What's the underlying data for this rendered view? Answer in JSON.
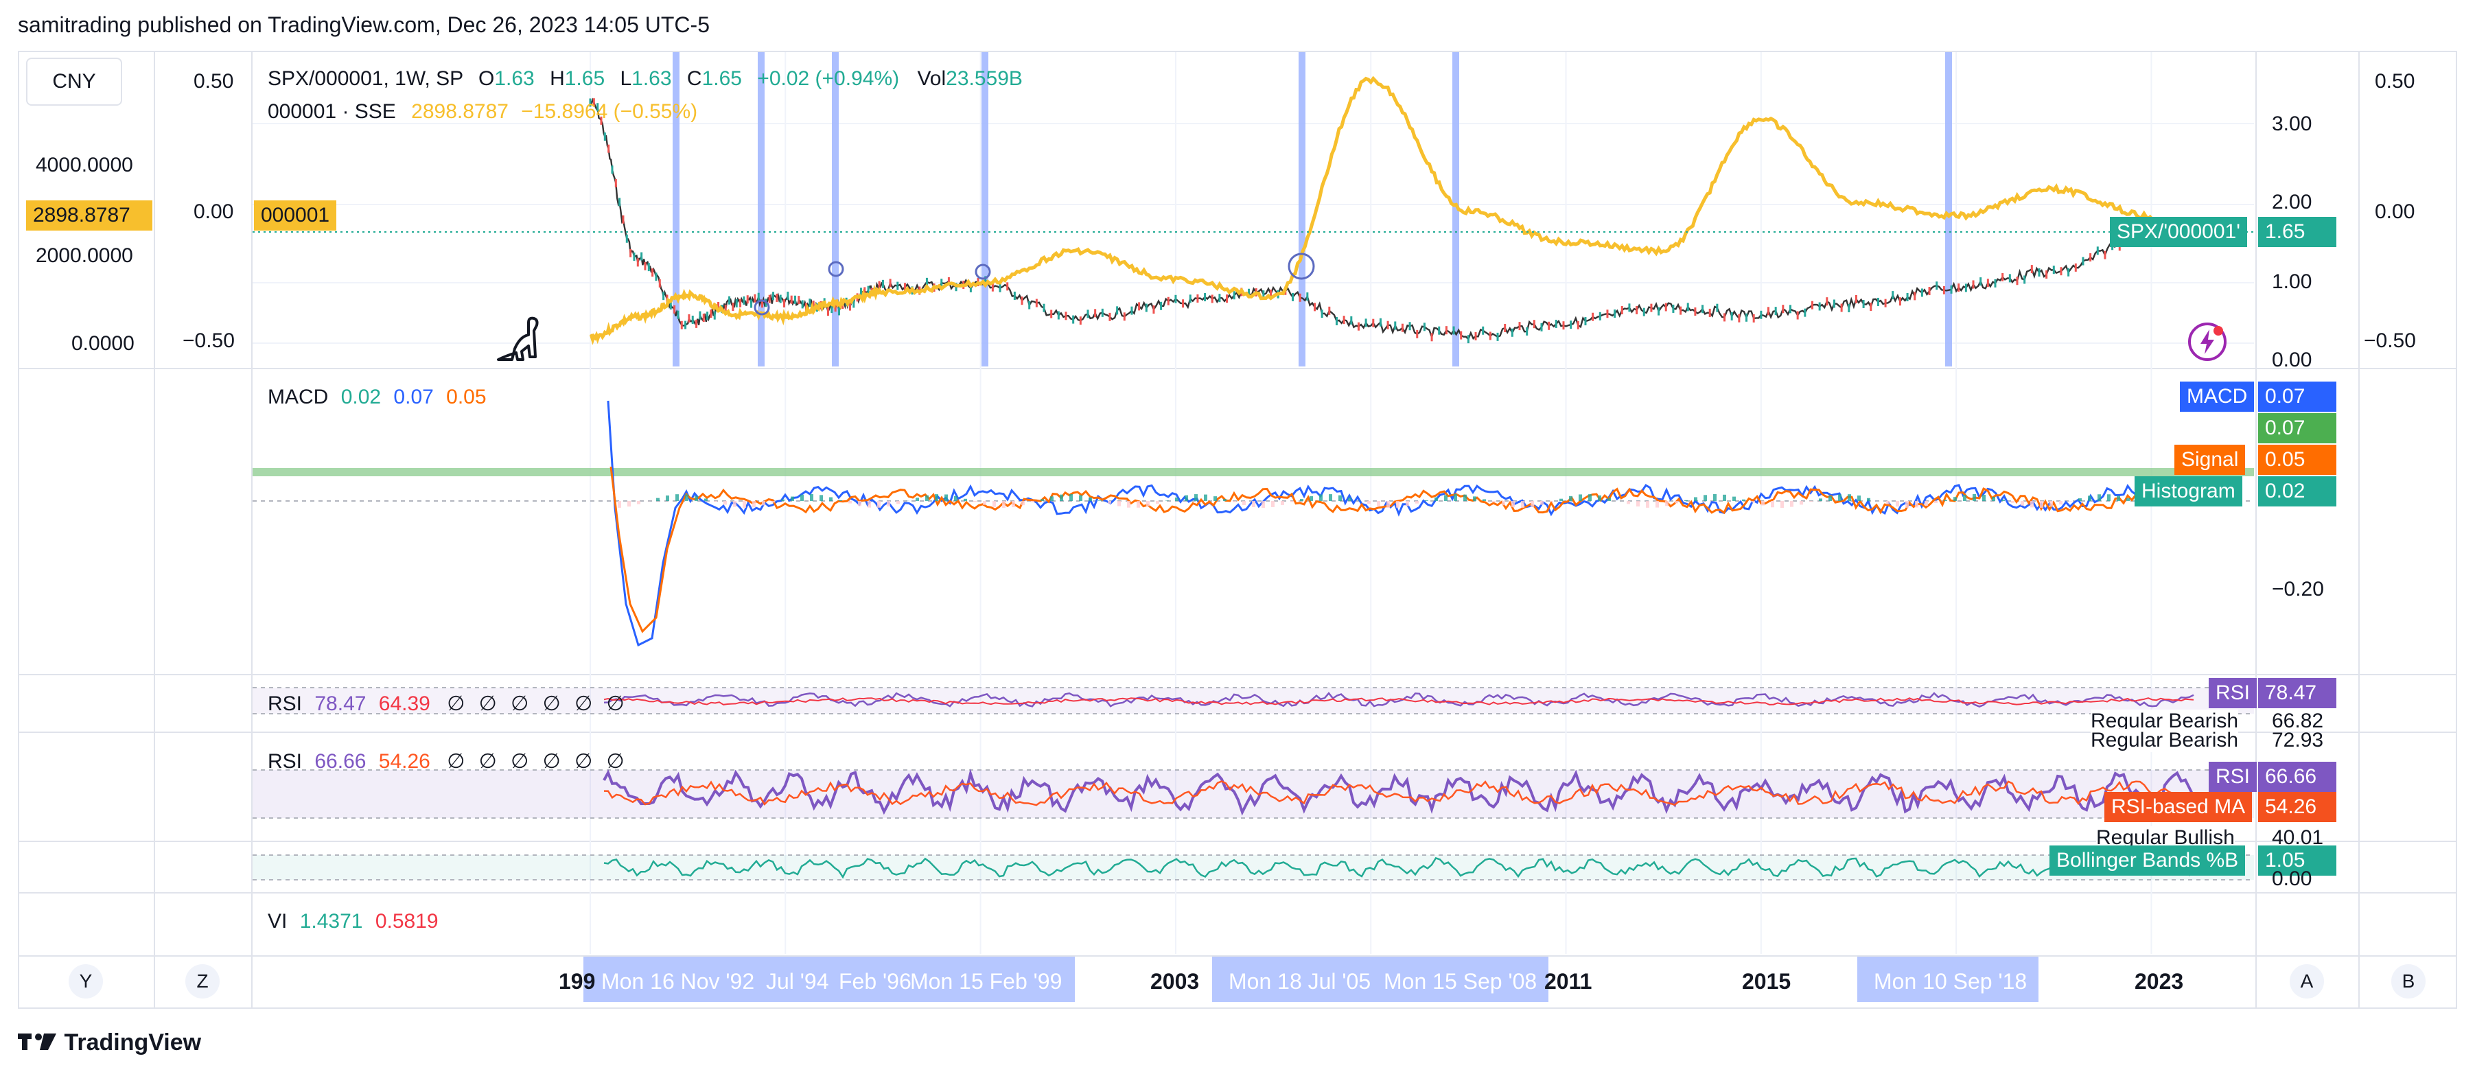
{
  "header": {
    "text": "samitrading published on TradingView.com, Dec 26, 2023 14:05 UTC-5"
  },
  "footer": {
    "brand": "TradingView"
  },
  "currency": "CNY",
  "main_legend": {
    "symbol": "SPX/000001, 1W, SP",
    "o_label": "O",
    "o": "1.63",
    "h_label": "H",
    "h": "1.65",
    "l_label": "L",
    "l": "1.63",
    "c_label": "C",
    "c": "1.65",
    "change": "+0.02 (+0.94%)",
    "vol_label": "Vol",
    "vol": "23.559B",
    "compare_symbol": "000001 · SSE",
    "compare_value": "2898.8787",
    "compare_change": "−15.8964 (−0.55%)"
  },
  "left_scale": {
    "ticks": [
      "4000.0000",
      "2000.0000",
      "0.0000"
    ],
    "current": "2898.8787"
  },
  "pct_scale": {
    "ticks": [
      "0.50",
      "0.00",
      "−0.50"
    ],
    "flag": "000001"
  },
  "right_scale": {
    "ticks": [
      "3.00",
      "2.00",
      "1.00",
      "0.00"
    ],
    "pct_ticks": [
      "0.50",
      "0.00",
      "−0.50"
    ]
  },
  "price_tag": {
    "label": "SPX/'000001'",
    "value": "1.65"
  },
  "macd": {
    "legend_name": "MACD",
    "v1": "0.02",
    "v2": "0.07",
    "v3": "0.05",
    "tags": [
      {
        "label": "MACD",
        "value": "0.07"
      },
      {
        "label": "",
        "value": "0.07"
      },
      {
        "label": "Signal",
        "value": "0.05"
      },
      {
        "label": "Histogram",
        "value": "0.02"
      }
    ],
    "tick": "−0.20"
  },
  "rsi1": {
    "legend_name": "RSI",
    "v1": "78.47",
    "v2": "64.39",
    "rest": "∅ ∅ ∅ ∅ ∅ ∅",
    "tag_label": "RSI",
    "tag_value": "78.47",
    "notes": [
      {
        "label": "Regular Bearish",
        "value": "66.82"
      },
      {
        "label": "Regular Bearish",
        "value": "72.93"
      }
    ]
  },
  "rsi2": {
    "legend_name": "RSI",
    "v1": "66.66",
    "v2": "54.26",
    "rest": "∅ ∅ ∅ ∅ ∅ ∅",
    "tags": [
      {
        "label": "RSI",
        "value": "66.66"
      },
      {
        "label": "RSI-based MA",
        "value": "54.26"
      }
    ],
    "note": {
      "label": "Regular Bullish",
      "value": "40.01"
    }
  },
  "bb": {
    "tag_label": "Bollinger Bands %B",
    "tag_value": "1.05",
    "tick": "0.00"
  },
  "vi": {
    "legend_name": "VI",
    "v1": "1.4371",
    "v2": "0.5819"
  },
  "x_axis": {
    "labels": [
      "199",
      "2003",
      "2011",
      "2015",
      "2023"
    ],
    "range_labels": [
      "Mon 16 Nov '92",
      "Jul '94",
      "Feb '96",
      "Mon 15 Feb '99",
      "Mon 18 Jul '05",
      "Mon 15 Sep '08",
      "Mon 10 Sep '18"
    ]
  },
  "buttons": {
    "y": "Y",
    "z": "Z",
    "a": "A",
    "b": "B"
  },
  "colors": {
    "ratio_up": "#26a69a",
    "ratio_down": "#ef5350",
    "compare": "#f7bf2d",
    "macd": "#2962ff",
    "signal": "#ff6d00",
    "rsi": "#7e57c2",
    "teal": "#22ab94",
    "highlight": "#9db4ff"
  },
  "chart_data": [
    {
      "type": "line",
      "title": "SPX/000001, 1W, SP",
      "series": [
        {
          "name": "SPX/000001",
          "x": [
            1991,
            1992,
            1993,
            1994,
            1995,
            1996,
            1997,
            1999,
            2001,
            2003,
            2005,
            2007,
            2009,
            2011,
            2013,
            2015,
            2017,
            2019,
            2021,
            2023
          ],
          "values": [
            3.3,
            1.3,
            0.5,
            0.75,
            0.8,
            0.7,
            0.95,
            1.0,
            0.55,
            0.75,
            0.9,
            0.45,
            0.35,
            0.5,
            0.7,
            0.6,
            0.75,
            0.95,
            1.15,
            1.65
          ]
        },
        {
          "name": "000001 · SSE",
          "x": [
            1991,
            1992,
            1993,
            1994,
            1995,
            1996,
            1997,
            1999,
            2001,
            2003,
            2005,
            2007,
            2009,
            2011,
            2013,
            2015,
            2017,
            2019,
            2021,
            2023
          ],
          "values": [
            130,
            600,
            1100,
            650,
            600,
            900,
            1150,
            1350,
            2100,
            1450,
            1050,
            6000,
            3000,
            2300,
            2100,
            5100,
            3200,
            2900,
            3500,
            2898.8787
          ]
        }
      ]
    },
    {
      "type": "line",
      "title": "MACD",
      "values_shown": {
        "macd": 0.07,
        "signal": 0.05,
        "histogram": 0.02
      }
    },
    {
      "type": "line",
      "title": "RSI",
      "values_shown": [
        78.47,
        64.39
      ]
    },
    {
      "type": "line",
      "title": "RSI",
      "values_shown": [
        66.66,
        54.26
      ]
    },
    {
      "type": "line",
      "title": "Bollinger Bands %B",
      "values_shown": [
        1.05
      ]
    }
  ]
}
